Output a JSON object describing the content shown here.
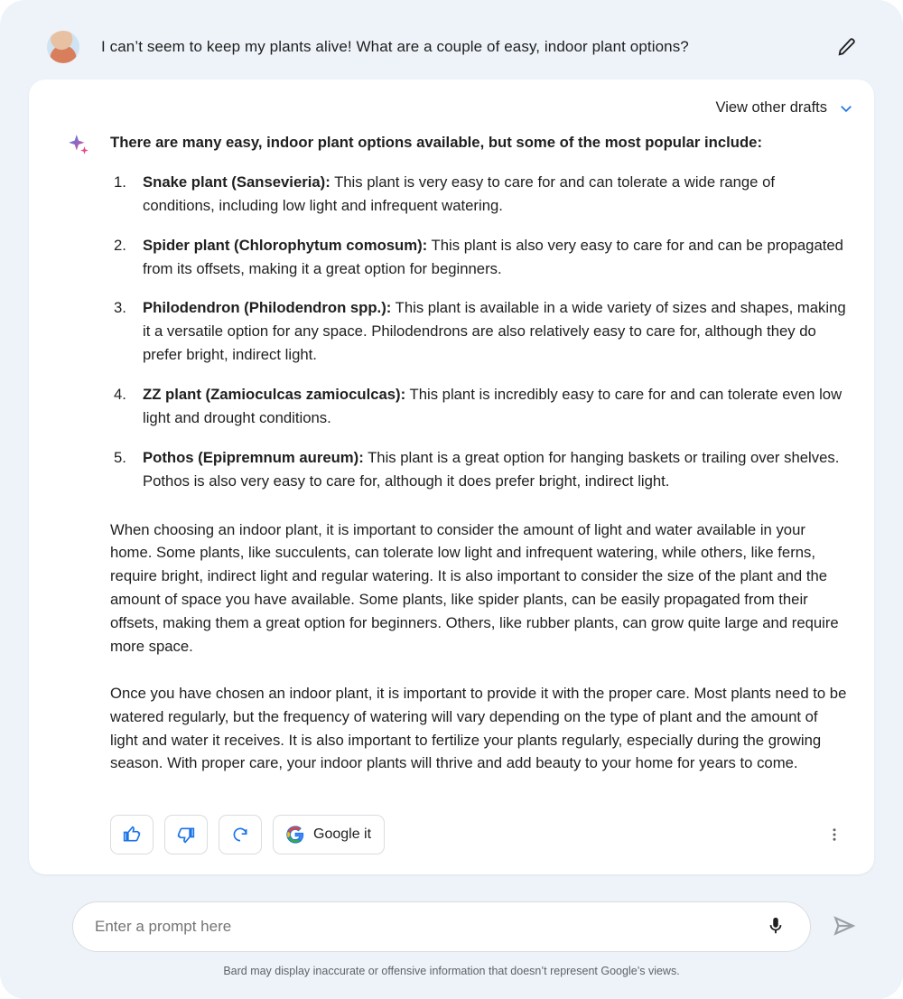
{
  "user": {
    "prompt": "I can’t seem to keep my plants alive! What are a couple of easy, indoor plant options?"
  },
  "drafts": {
    "label": "View other drafts"
  },
  "response": {
    "intro": "There are many easy, indoor plant options available, but some of the most popular include:",
    "items": [
      {
        "name": "Snake plant (Sansevieria):",
        "desc": " This plant is very easy to care for and can tolerate a wide range of conditions, including low light and infrequent watering."
      },
      {
        "name": "Spider plant (Chlorophytum comosum):",
        "desc": " This plant is also very easy to care for and can be propagated from its offsets, making it a great option for beginners."
      },
      {
        "name": "Philodendron (Philodendron spp.):",
        "desc": " This plant is available in a wide variety of sizes and shapes, making it a versatile option for any space. Philodendrons are also relatively easy to care for, although they do prefer bright, indirect light."
      },
      {
        "name": "ZZ plant (Zamioculcas zamioculcas):",
        "desc": " This plant is incredibly easy to care for and can tolerate even low light and drought conditions."
      },
      {
        "name": "Pothos (Epipremnum aureum):",
        "desc": " This plant is a great option for hanging baskets or trailing over shelves. Pothos is also very easy to care for, although it does prefer bright, indirect light."
      }
    ],
    "para1": "When choosing an indoor plant, it is important to consider the amount of light and water available in your home. Some plants, like succulents, can tolerate low light and infrequent watering, while others, like ferns, require bright, indirect light and regular watering. It is also important to consider the size of the plant and the amount of space you have available. Some plants, like spider plants, can be easily propagated from their offsets, making them a great option for beginners. Others, like rubber plants, can grow quite large and require more space.",
    "para2": "Once you have chosen an indoor plant, it is important to provide it with the proper care. Most plants need to be watered regularly, but the frequency of watering will vary depending on the type of plant and the amount of light and water it receives. It is also important to fertilize your plants regularly, especially during the growing season. With proper care, your indoor plants will thrive and add beauty to your home for years to come."
  },
  "actions": {
    "google_it": "Google it"
  },
  "input": {
    "placeholder": "Enter a prompt here"
  },
  "disclaimer": "Bard may display inaccurate or offensive information that doesn’t represent Google’s views."
}
